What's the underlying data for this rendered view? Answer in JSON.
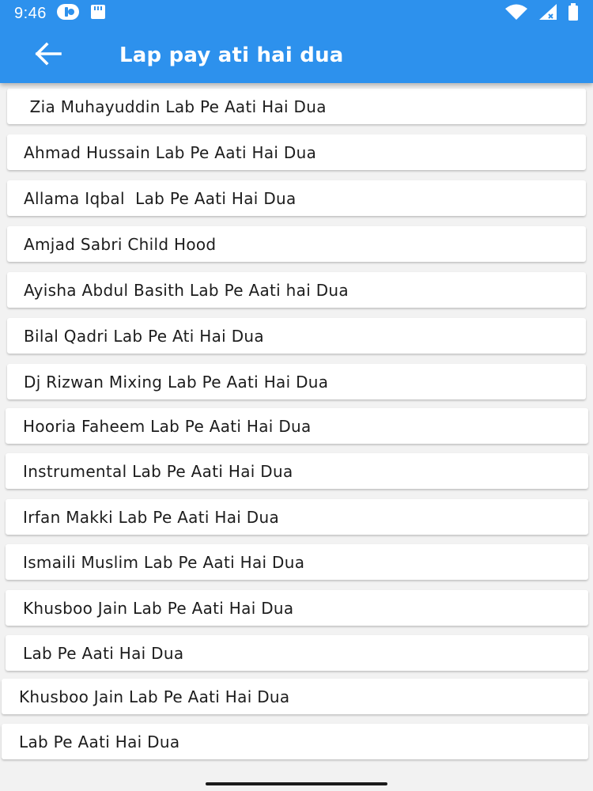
{
  "status_bar": {
    "time": "9:46",
    "icons": [
      "notification-app-icon",
      "sd-card-icon",
      "wifi-icon",
      "cellular-signal-icon",
      "battery-icon"
    ]
  },
  "app_bar": {
    "back_icon": "arrow-left-icon",
    "title": "Lap pay ati hai dua",
    "background_color": "#2d91ed",
    "text_color": "#ffffff"
  },
  "list": {
    "items": [
      {
        "label": " Zia Muhayuddin Lab Pe Aati Hai Dua"
      },
      {
        "label": "Ahmad Hussain Lab Pe Aati Hai Dua"
      },
      {
        "label": "Allama Iqbal  Lab Pe Aati Hai Dua"
      },
      {
        "label": "Amjad Sabri Child Hood"
      },
      {
        "label": "Ayisha Abdul Basith Lab Pe Aati hai Dua"
      },
      {
        "label": "Bilal Qadri Lab Pe Ati Hai Dua"
      },
      {
        "label": "Dj Rizwan Mixing Lab Pe Aati Hai Dua"
      },
      {
        "label": "Hooria Faheem Lab Pe Aati Hai Dua"
      },
      {
        "label": "Instrumental Lab Pe Aati Hai Dua"
      },
      {
        "label": "Irfan Makki Lab Pe Aati Hai Dua"
      },
      {
        "label": "Ismaili Muslim Lab Pe Aati Hai Dua"
      },
      {
        "label": "Khusboo Jain Lab Pe Aati Hai Dua"
      },
      {
        "label": "Lab Pe Aati Hai Dua"
      },
      {
        "label": "Khusboo Jain Lab Pe Aati Hai Dua"
      },
      {
        "label": "Lab Pe Aati Hai Dua"
      }
    ]
  }
}
